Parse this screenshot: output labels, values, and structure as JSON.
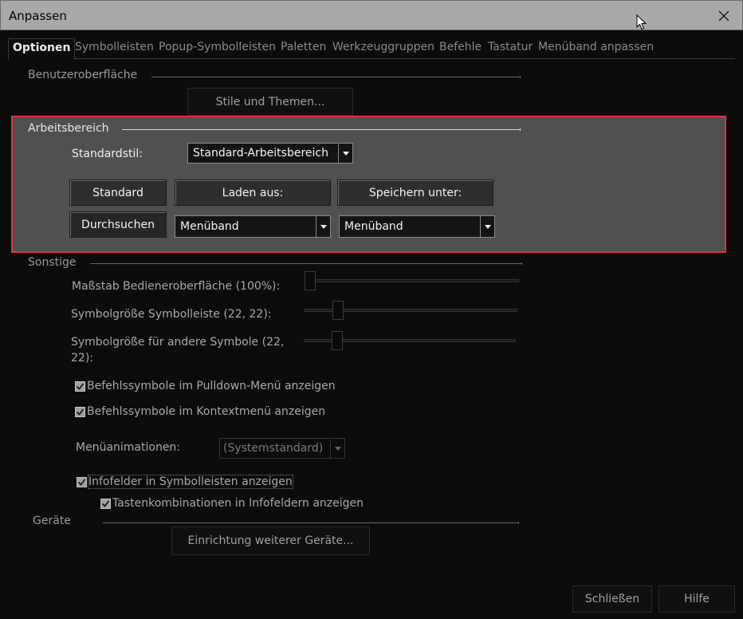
{
  "window": {
    "title": "Anpassen"
  },
  "tabs": [
    {
      "label": "Optionen"
    },
    {
      "label": "Symbolleisten"
    },
    {
      "label": "Popup-Symbolleisten"
    },
    {
      "label": "Paletten"
    },
    {
      "label": "Werkzeuggruppen"
    },
    {
      "label": "Befehle"
    },
    {
      "label": "Tastatur"
    },
    {
      "label": "Menüband anpassen"
    }
  ],
  "ui_group": {
    "label": "Benutzeroberfläche",
    "styles_button": "Stile und Themen..."
  },
  "workspace": {
    "label": "Arbeitsbereich",
    "default_style_label": "Standardstil:",
    "default_style_value": "Standard-Arbeitsbereich",
    "standard_button": "Standard",
    "load_button": "Laden aus:",
    "save_button": "Speichern unter:",
    "browse_button": "Durchsuchen",
    "load_value": "Menüband",
    "save_value": "Menüband"
  },
  "misc": {
    "label": "Sonstige",
    "scale_label": "Maßstab Bedieneroberfläche (100%):",
    "toolbar_icon_label": "Symbolgröße Symbolleiste (22, 22):",
    "other_icon_label_1": "Symbolgröße für andere Symbole (22,",
    "other_icon_label_2": "22):",
    "scale_level": 0.0,
    "toolbar_icon_level": 0.14,
    "other_icon_level": 0.14,
    "show_pulldown_icons": "Befehlssymbole im Pulldown-Menü anzeigen",
    "show_context_icons": "Befehlssymbole im Kontextmenü anzeigen",
    "menu_animation_label": "Menüanimationen:",
    "menu_animation_value": "(Systemstandard)",
    "show_tooltips": "Infofelder in Symbolleisten anzeigen",
    "show_shortcuts_in_tooltips": "Tastenkombinationen in Infofeldern anzeigen"
  },
  "devices": {
    "label": "Geräte",
    "setup_button": "Einrichtung weiterer Geräte..."
  },
  "footer": {
    "close_button": "Schließen",
    "help_button": "Hilfe"
  },
  "colors": {
    "highlight_border": "#e0333c",
    "panel_bg": "#505050",
    "titlebar_bg": "#a8a8a8"
  }
}
